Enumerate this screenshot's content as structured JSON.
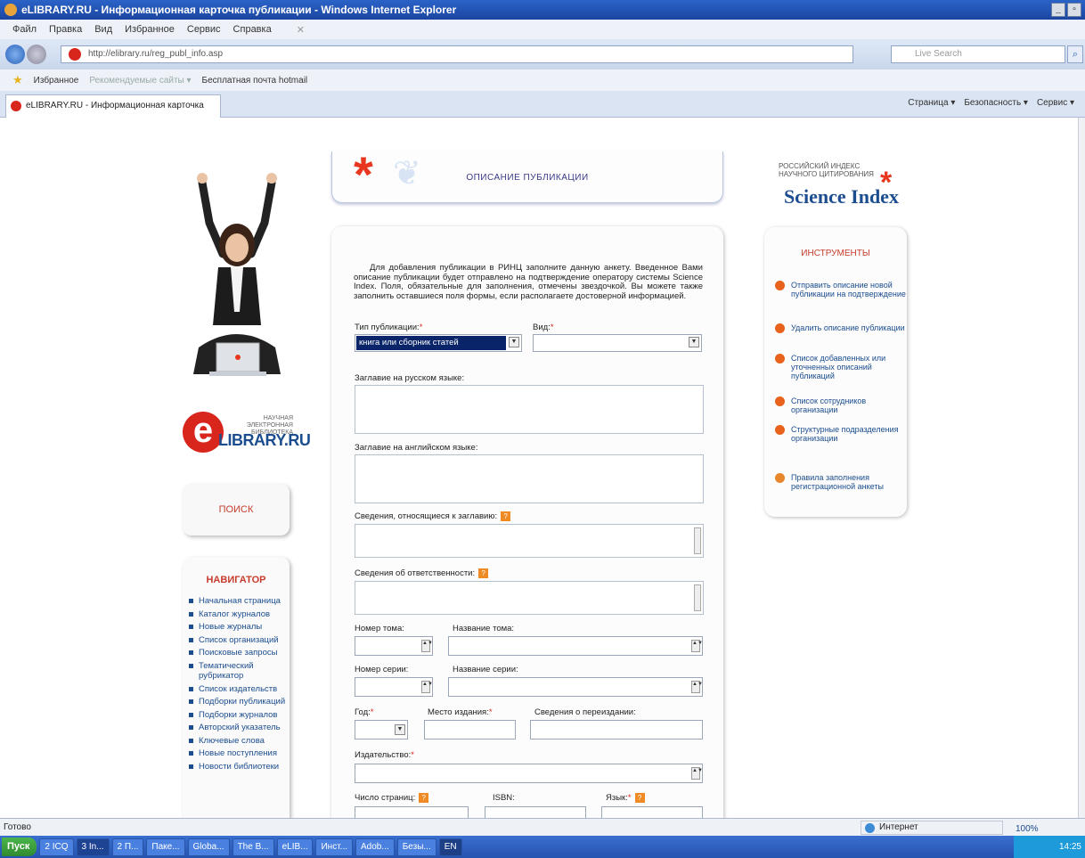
{
  "window": {
    "title": "eLIBRARY.RU - Информационная карточка публикации - Windows Internet Explorer"
  },
  "menu": [
    "Файл",
    "Правка",
    "Вид",
    "Избранное",
    "Сервис",
    "Справка"
  ],
  "address": {
    "url": "http://elibrary.ru/reg_publ_info.asp",
    "search_placeholder": "Live Search"
  },
  "favorites": {
    "label": "Избранное",
    "suggested": "Рекомендуемые сайты ▾",
    "hotmail": "Бесплатная почта hotmail"
  },
  "tab": {
    "label": "eLIBRARY.RU - Информационная карточка публика..."
  },
  "commandbar": [
    "Страница ▾",
    "Безопасность ▾",
    "Сервис ▾"
  ],
  "header": {
    "title": "ОПИСАНИЕ ПУБЛИКАЦИИ"
  },
  "science_index": {
    "line1": "РОССИЙСКИЙ ИНДЕКС",
    "line2": "НАУЧНОГО ЦИТИРОВАНИЯ",
    "brand": "Science Index"
  },
  "elibrary_logo": {
    "tagline1": "НАУЧНАЯ ЭЛЕКТРОННАЯ",
    "tagline2": "БИБЛИОТЕКА",
    "brand": "LIBRARY.RU"
  },
  "search_panel": {
    "label": "ПОИСК"
  },
  "navigator": {
    "title": "НАВИГАТОР",
    "items": [
      "Начальная страница",
      "Каталог журналов",
      "Новые журналы",
      "Список организаций",
      "Поисковые запросы",
      "Тематический рубрикатор",
      "Список издательств",
      "Подборки публикаций",
      "Подборки журналов",
      "Авторский указатель",
      "Ключевые слова",
      "Новые поступления",
      "Новости библиотеки"
    ]
  },
  "form": {
    "intro": "Для добавления публикации в РИНЦ заполните данную анкету. Введенное Вами описание публикации будет отправлено на подтверждение оператору системы Science Index. Поля, обязательные для заполнения, отмечены звездочкой. Вы можете также заполнить оставшиеся поля формы, если располагаете достоверной информацией.",
    "pub_type_label": "Тип публикации:",
    "pub_type_value": "книга или сборник статей",
    "kind_label": "Вид:",
    "title_ru_label": "Заглавие на русском языке:",
    "title_en_label": "Заглавие на английском языке:",
    "title_info_label": "Сведения, относящиеся к заглавию:",
    "responsibility_label": "Сведения об ответственности:",
    "volume_num_label": "Номер тома:",
    "volume_name_label": "Название тома:",
    "series_num_label": "Номер серии:",
    "series_name_label": "Название серии:",
    "year_label": "Год:",
    "place_label": "Место издания:",
    "reprint_label": "Сведения о переиздании:",
    "publisher_label": "Издательство:",
    "pages_label": "Число страниц:",
    "isbn_label": "ISBN:",
    "language_label": "Язык:"
  },
  "tools": {
    "title": "ИНСТРУМЕНТЫ",
    "items": [
      "Отправить описание новой публикации на подтверждение",
      "Удалить описание публикации",
      "Список добавленных или уточненных описаний публикаций",
      "Список сотрудников организации",
      "Структурные подразделения организации",
      "Правила заполнения регистрационной анкеты"
    ]
  },
  "status": {
    "left": "Готово",
    "zone": "Интернет",
    "zoom": "100%"
  },
  "taskbar": {
    "start": "Пуск",
    "items": [
      "2 ICQ",
      "3 In...",
      "2 П...",
      "Паке...",
      "Globa...",
      "The B...",
      "eLIB...",
      "Инст...",
      "Adob...",
      "Безы..."
    ],
    "lang": "EN",
    "clock": "14:25"
  },
  "colors": {
    "accent_red": "#d9261c",
    "nav_blue": "#1b4d8f",
    "orange": "#f08a24"
  }
}
